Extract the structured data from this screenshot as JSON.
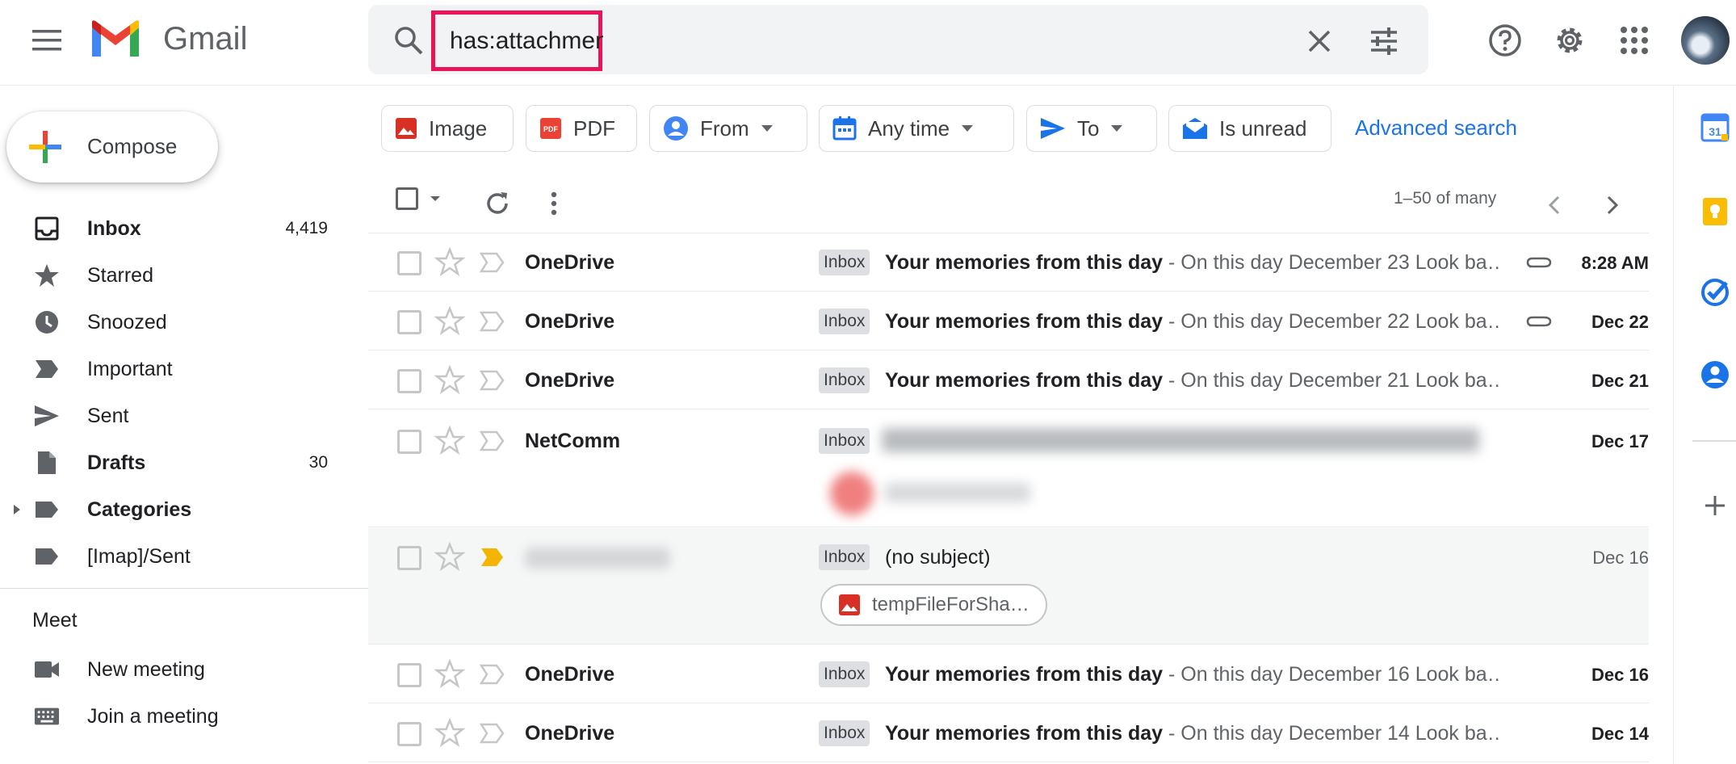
{
  "app": {
    "name": "Gmail"
  },
  "search": {
    "query": "has:attachment"
  },
  "compose": {
    "label": "Compose"
  },
  "nav": [
    {
      "label": "Inbox",
      "count": "4,419",
      "bold": true,
      "icon": "inbox-icon"
    },
    {
      "label": "Starred",
      "count": "",
      "bold": false,
      "icon": "star-icon"
    },
    {
      "label": "Snoozed",
      "count": "",
      "bold": false,
      "icon": "clock-icon"
    },
    {
      "label": "Important",
      "count": "",
      "bold": false,
      "icon": "important-icon"
    },
    {
      "label": "Sent",
      "count": "",
      "bold": false,
      "icon": "send-icon"
    },
    {
      "label": "Drafts",
      "count": "30",
      "bold": true,
      "icon": "draft-icon"
    },
    {
      "label": "Categories",
      "count": "",
      "bold": true,
      "icon": "label-icon"
    },
    {
      "label": "[Imap]/Sent",
      "count": "",
      "bold": false,
      "icon": "label-icon"
    }
  ],
  "meet": {
    "title": "Meet",
    "items": [
      {
        "label": "New meeting",
        "icon": "video-icon"
      },
      {
        "label": "Join a meeting",
        "icon": "keyboard-icon"
      }
    ]
  },
  "filters": {
    "chips": [
      {
        "label": "Image",
        "icon": "image-icon",
        "dropdown": false
      },
      {
        "label": "PDF",
        "icon": "pdf-icon",
        "dropdown": false
      },
      {
        "label": "From",
        "icon": "person-icon",
        "dropdown": true
      },
      {
        "label": "Any time",
        "icon": "calendar-icon",
        "dropdown": true
      },
      {
        "label": "To",
        "icon": "send-icon",
        "dropdown": true
      },
      {
        "label": "Is unread",
        "icon": "mail-icon",
        "dropdown": false
      }
    ],
    "advanced": "Advanced search"
  },
  "pager": {
    "text": "1–50 of many"
  },
  "emails": [
    {
      "sender": "OneDrive",
      "badge": "Inbox",
      "subject": "Your memories from this day",
      "preview": " - On this day December 23 Look ba…",
      "date": "8:28 AM",
      "unread": true,
      "attachment_icon": true
    },
    {
      "sender": "OneDrive",
      "badge": "Inbox",
      "subject": "Your memories from this day",
      "preview": " - On this day December 22 Look ba…",
      "date": "Dec 22",
      "unread": true,
      "attachment_icon": true
    },
    {
      "sender": "OneDrive",
      "badge": "Inbox",
      "subject": "Your memories from this day",
      "preview": " - On this day December 21 Look ba…",
      "date": "Dec 21",
      "unread": true,
      "attachment_icon": false
    },
    {
      "sender": "NetComm",
      "badge": "Inbox",
      "subject": "",
      "preview": "",
      "date": "Dec 17",
      "unread": true,
      "attachment_icon": false
    },
    {
      "sender": "",
      "badge": "Inbox",
      "subject": "(no subject)",
      "preview": "",
      "date": "Dec 16",
      "unread": false,
      "attachment_icon": false,
      "attachment": "tempFileForSha…"
    },
    {
      "sender": "OneDrive",
      "badge": "Inbox",
      "subject": "Your memories from this day",
      "preview": " - On this day December 16 Look ba…",
      "date": "Dec 16",
      "unread": true,
      "attachment_icon": false
    },
    {
      "sender": "OneDrive",
      "badge": "Inbox",
      "subject": "Your memories from this day",
      "preview": " - On this day December 14 Look ba…",
      "date": "Dec 14",
      "unread": true,
      "attachment_icon": false
    }
  ],
  "colors": {
    "accent": "#1a73e8",
    "highlight": "#ea1559",
    "important": "#f4b400"
  }
}
